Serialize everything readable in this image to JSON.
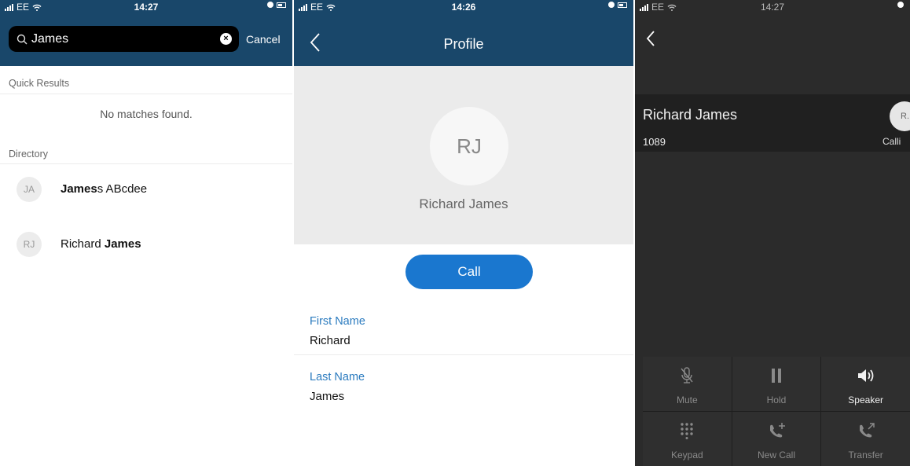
{
  "status": {
    "left": {
      "carrier": "EE",
      "time": "14:27"
    },
    "middle": {
      "carrier": "EE",
      "time": "14:26"
    },
    "right": {
      "carrier": "EE",
      "time": "14:27"
    }
  },
  "search_screen": {
    "query": "James",
    "cancel_label": "Cancel",
    "quick_results_header": "Quick Results",
    "no_matches": "No matches found.",
    "directory_header": "Directory",
    "results": [
      {
        "initials": "JA",
        "bold": "James",
        "rest": "s ABcdee"
      },
      {
        "initials": "RJ",
        "prefix": "Richard ",
        "bold": "James"
      }
    ]
  },
  "profile_screen": {
    "title": "Profile",
    "initials": "RJ",
    "name": "Richard James",
    "call_label": "Call",
    "fields": [
      {
        "label": "First Name",
        "value": "Richard"
      },
      {
        "label": "Last Name",
        "value": "James"
      }
    ]
  },
  "call_screen": {
    "name": "Richard James",
    "number": "1089",
    "avatar_initials": "R.",
    "status": "Calli",
    "controls": [
      {
        "label": "Mute",
        "icon": "mic-muted-icon",
        "active": false
      },
      {
        "label": "Hold",
        "icon": "pause-icon",
        "active": false
      },
      {
        "label": "Speaker",
        "icon": "speaker-icon",
        "active": true
      },
      {
        "label": "Keypad",
        "icon": "keypad-icon",
        "active": false
      },
      {
        "label": "New Call",
        "icon": "add-call-icon",
        "active": false
      },
      {
        "label": "Transfer",
        "icon": "transfer-call-icon",
        "active": false
      }
    ]
  }
}
